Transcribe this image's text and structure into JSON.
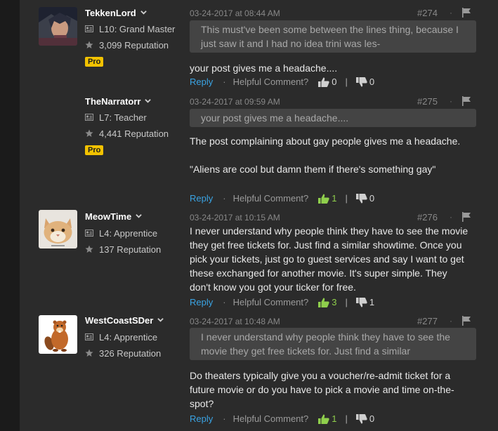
{
  "colors": {
    "accent": "#3aa3e3",
    "pro_badge": "#f2c200",
    "upvote": "#8fcf4c"
  },
  "posts": [
    {
      "username": "TekkenLord",
      "level": "L10: Grand Master",
      "reputation": "3,099 Reputation",
      "pro": "Pro",
      "date": "03-24-2017 at 08:44 AM",
      "number": "#274",
      "quote": "This must've been some between the lines thing, because I just saw it and I had no idea trini was les-",
      "body": "your post gives me a headache....",
      "reply": "Reply",
      "helpful": "Helpful Comment?",
      "up": "0",
      "down": "0",
      "avatar_icon": "character-avatar"
    },
    {
      "username": "TheNarratorr",
      "level": "L7: Teacher",
      "reputation": "4,441 Reputation",
      "pro": "Pro",
      "date": "03-24-2017 at 09:59 AM",
      "number": "#275",
      "quote": "your post gives me a headache....",
      "body": "The post complaining about gay people gives me a headache.\n\n\"Aliens are cool but damn them if there's something gay\"",
      "reply": "Reply",
      "helpful": "Helpful Comment?",
      "up": "1",
      "down": "0"
    },
    {
      "username": "MeowTime",
      "level": "L4: Apprentice",
      "reputation": "137 Reputation",
      "date": "03-24-2017 at 10:15 AM",
      "number": "#276",
      "body": "I never understand why people think they have to see the movie they get free tickets for. Just find a similar showtime. Once you pick your tickets, just go to guest services and say I want to get these exchanged for another movie. It's super simple. They don't know you got your ticker for free.",
      "reply": "Reply",
      "helpful": "Helpful Comment?",
      "up": "3",
      "down": "1",
      "avatar_icon": "cat-avatar"
    },
    {
      "username": "WestCoastSDer",
      "level": "L4: Apprentice",
      "reputation": "326 Reputation",
      "date": "03-24-2017 at 10:48 AM",
      "number": "#277",
      "quote": "I never understand why people think they have to see the movie they get free tickets for. Just find a similar",
      "body": "Do theaters typically give you a voucher/re-admit ticket for a future movie or do you have to pick a movie and time on-the-spot?",
      "reply": "Reply",
      "helpful": "Helpful Comment?",
      "up": "1",
      "down": "0",
      "avatar_icon": "beaver-avatar"
    }
  ]
}
